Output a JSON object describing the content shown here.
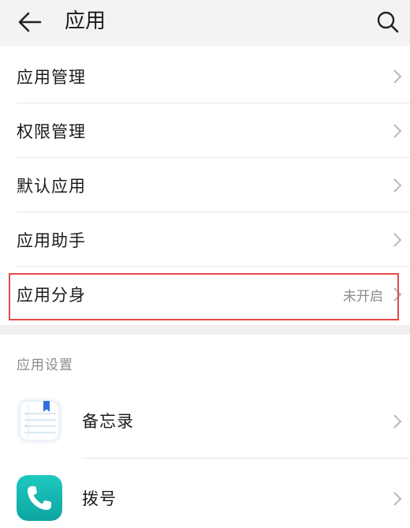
{
  "header": {
    "title": "应用",
    "back_icon": "arrow-left-icon",
    "search_icon": "search-icon"
  },
  "main_list": [
    {
      "label": "应用管理",
      "value": ""
    },
    {
      "label": "权限管理",
      "value": ""
    },
    {
      "label": "默认应用",
      "value": ""
    },
    {
      "label": "应用助手",
      "value": ""
    },
    {
      "label": "应用分身",
      "value": "未开启"
    }
  ],
  "settings_section": {
    "title": "应用设置",
    "apps": [
      {
        "label": "备忘录",
        "icon": "notepad-icon"
      },
      {
        "label": "拨号",
        "icon": "phone-icon"
      }
    ]
  },
  "colors": {
    "header_bg": "#f3f3f3",
    "highlight_border": "#e24b4b",
    "phone_icon_bg": "#14b5b0",
    "note_bookmark": "#2f6fe3"
  }
}
